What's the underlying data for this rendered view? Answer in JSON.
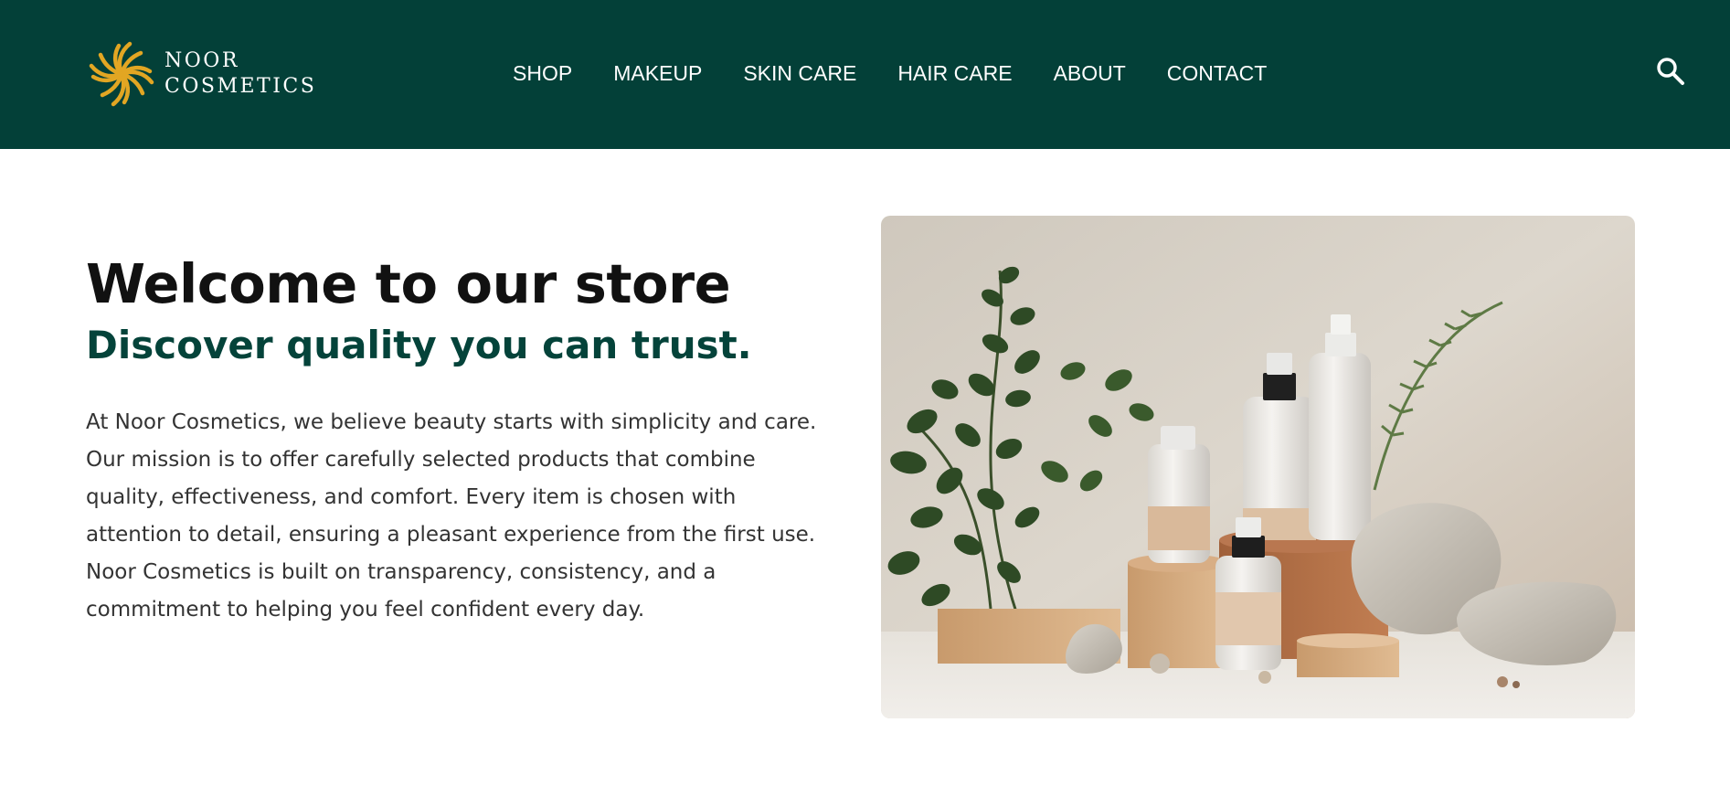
{
  "brand": {
    "line1": "NOOR",
    "line2": "COSMETICS",
    "logo_icon": "woven-star-logo",
    "logo_color": "#E2A623"
  },
  "colors": {
    "header_bg": "#034038",
    "subtitle": "#04433A",
    "title": "#111111",
    "body_text": "#333333"
  },
  "nav": {
    "items": [
      {
        "label": "SHOP"
      },
      {
        "label": "MAKEUP"
      },
      {
        "label": "SKIN CARE"
      },
      {
        "label": "HAIR CARE"
      },
      {
        "label": "ABOUT"
      },
      {
        "label": "CONTACT"
      }
    ],
    "search_icon": "search-icon"
  },
  "hero": {
    "title": "Welcome to our store",
    "subtitle": "Discover quality you can trust.",
    "body": "At Noor Cosmetics, we believe beauty starts with simplicity and care. Our mission is to offer carefully selected products that combine quality, effectiveness, and comfort. Every item is chosen with attention to detail, ensuring a pleasant experience from the first use. Noor Cosmetics is built on transparency, consistency, and a commitment to helping you feel confident every day.",
    "image_subject": "cosmetic bottles on wooden blocks with stones and green plants"
  }
}
